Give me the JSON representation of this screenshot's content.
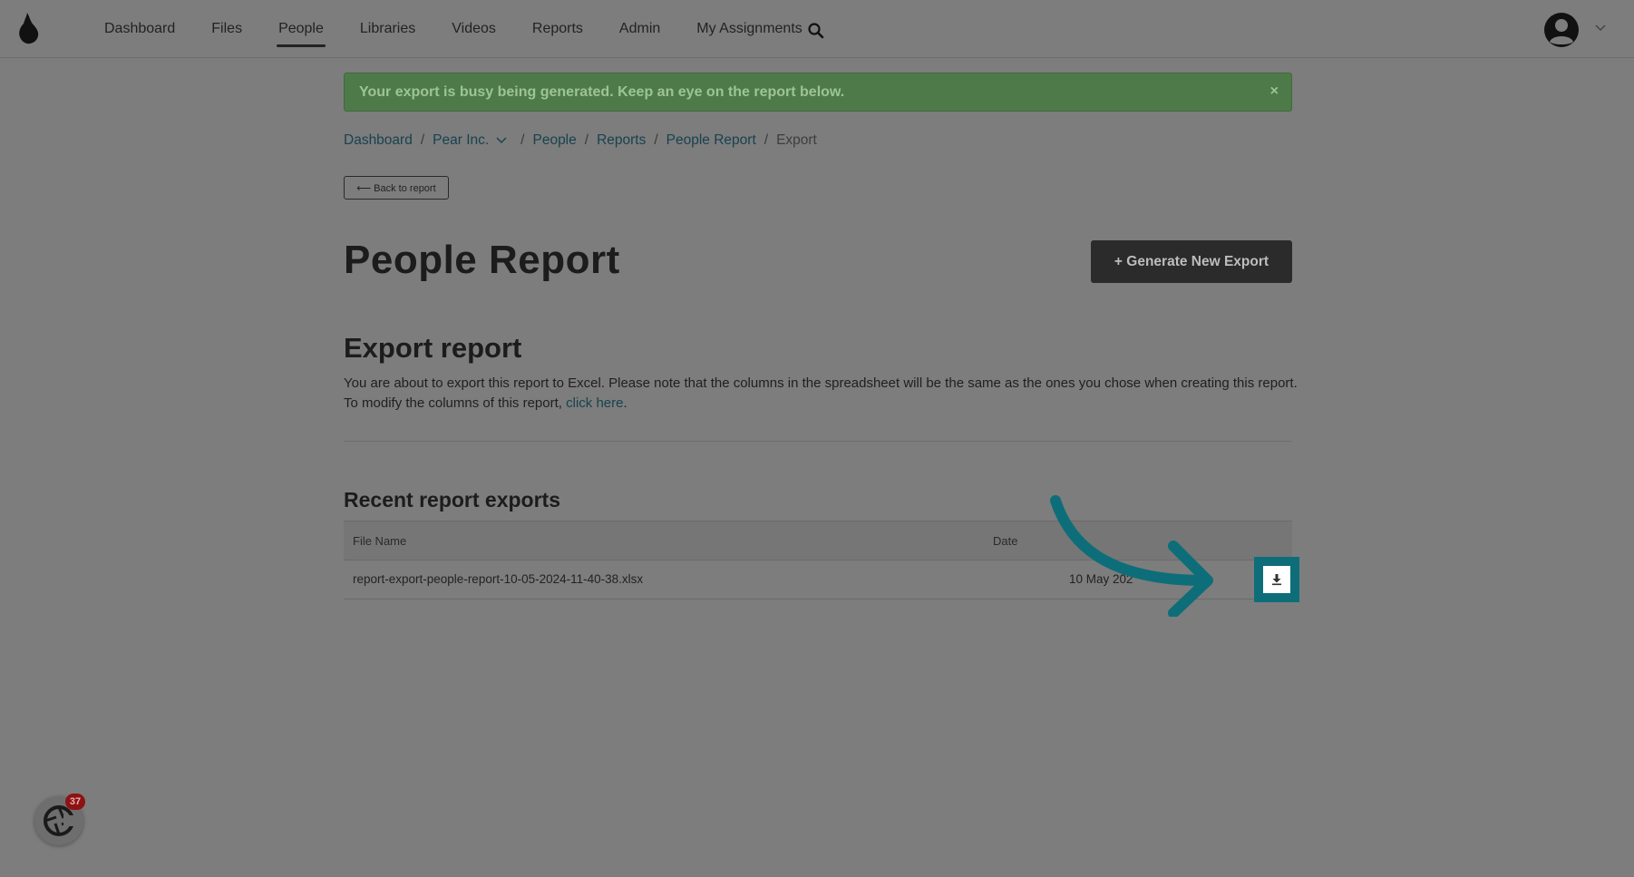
{
  "nav": {
    "items": [
      {
        "label": "Dashboard",
        "active": false
      },
      {
        "label": "Files",
        "active": false
      },
      {
        "label": "People",
        "active": true
      },
      {
        "label": "Libraries",
        "active": false
      },
      {
        "label": "Videos",
        "active": false
      },
      {
        "label": "Reports",
        "active": false
      },
      {
        "label": "Admin",
        "active": false
      },
      {
        "label": "My Assignments",
        "active": false
      }
    ],
    "search_icon": "search-icon",
    "avatar_icon": "user-avatar-icon"
  },
  "alert": {
    "message": "Your export is busy being generated. Keep an eye on the report below.",
    "close": "×"
  },
  "breadcrumb": {
    "items": [
      "Dashboard",
      "Pear Inc.",
      "People",
      "Reports",
      "People Report"
    ],
    "current": "Export",
    "separator": "/"
  },
  "back_button": "⟵ Back to report",
  "page_title": "People Report",
  "generate_button": "+ Generate New Export",
  "export_section": {
    "title": "Export report",
    "line1": "You are about to export this report to Excel. Please note that the columns in the spreadsheet will be the same as the ones you chose when creating this report.",
    "line2_prefix": "To modify the columns of this report,",
    "link": "click here",
    "line2_suffix": "."
  },
  "recent": {
    "title": "Recent report exports",
    "columns": [
      "File Name",
      "Date"
    ],
    "rows": [
      {
        "file": "report-export-people-report-10-05-2024-11-40-38.xlsx",
        "date": "10 May 202"
      }
    ]
  },
  "widget": {
    "badge": "37"
  },
  "colors": {
    "accent": "#0d6e79",
    "alert_bg": "#4e7a4a",
    "badge": "#8e1212"
  }
}
